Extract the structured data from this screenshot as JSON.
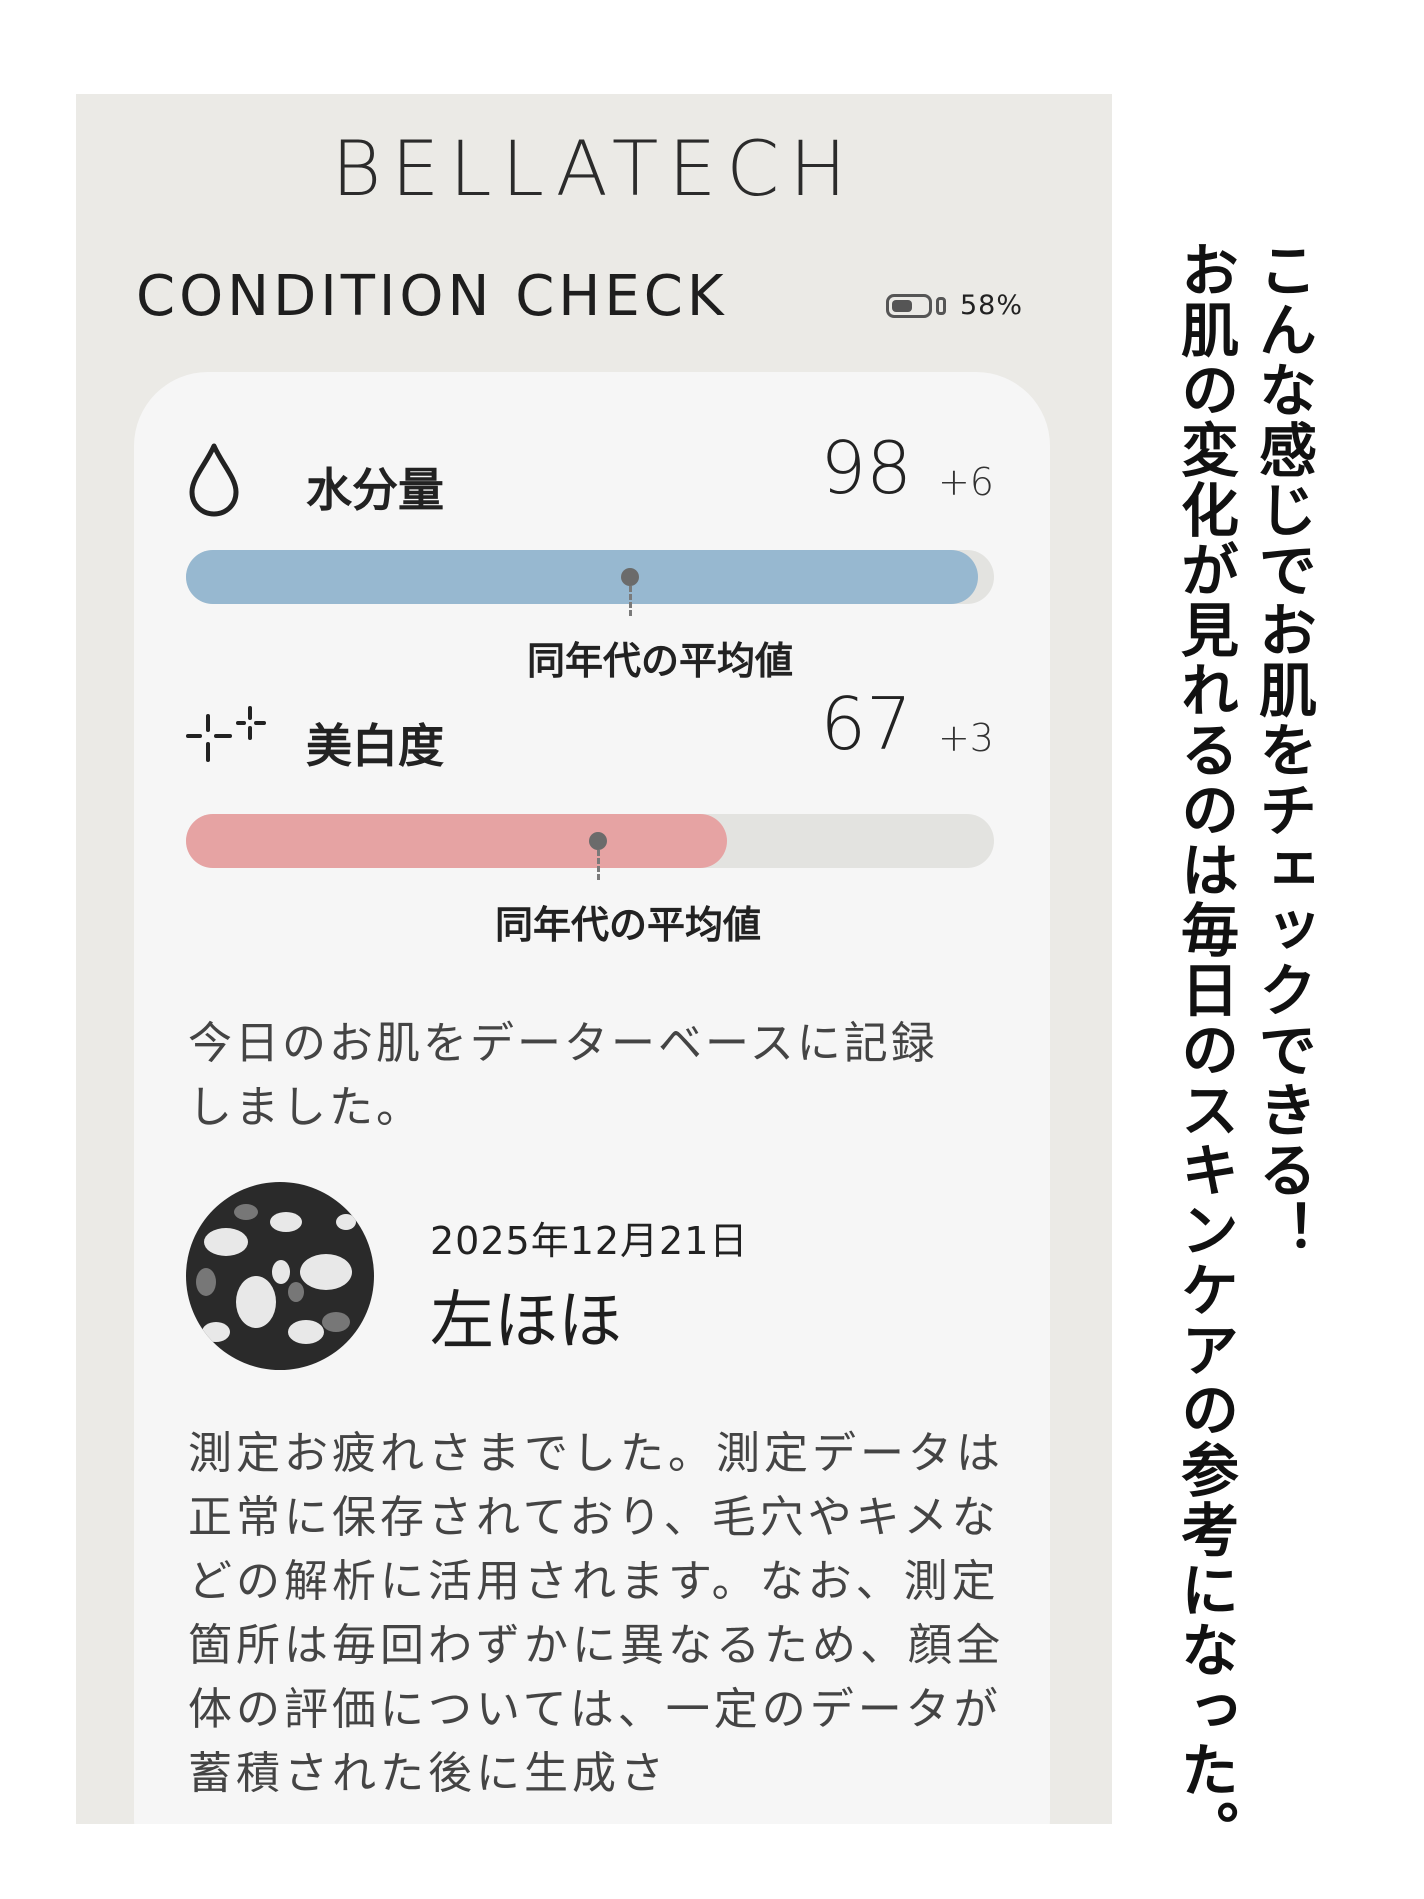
{
  "app": {
    "brand": "BELLATECH",
    "screen_title": "CONDITION CHECK",
    "battery": {
      "percent": 58,
      "label": "58%"
    }
  },
  "metrics": [
    {
      "icon": "water-drop-icon",
      "label": "水分量",
      "value": "98",
      "delta": "+6",
      "fill_fraction": 0.98,
      "average_fraction": 0.55,
      "average_label": "同年代の平均値",
      "color": "#97b8d0"
    },
    {
      "icon": "sparkle-icon",
      "label": "美白度",
      "value": "67",
      "delta": "+3",
      "fill_fraction": 0.67,
      "average_fraction": 0.51,
      "average_label": "同年代の平均値",
      "color": "#e6a3a3"
    }
  ],
  "record": {
    "message": "今日のお肌をデーターベースに記録しました。",
    "date": "2025年12月21日",
    "area": "左ほほ",
    "note": "測定お疲れさまでした。測定データは正常に保存されており、毛穴やキメなどの解析に活用されます。なお、測定箇所は毎回わずかに異なるため、顔全体の評価については、一定のデータが蓄積された後に生成さ"
  },
  "caption": {
    "line1": "こんな感じでお肌をチェックできる！",
    "line2": "お肌の変化が見れるのは毎日のスキンケアの参考になった。"
  }
}
